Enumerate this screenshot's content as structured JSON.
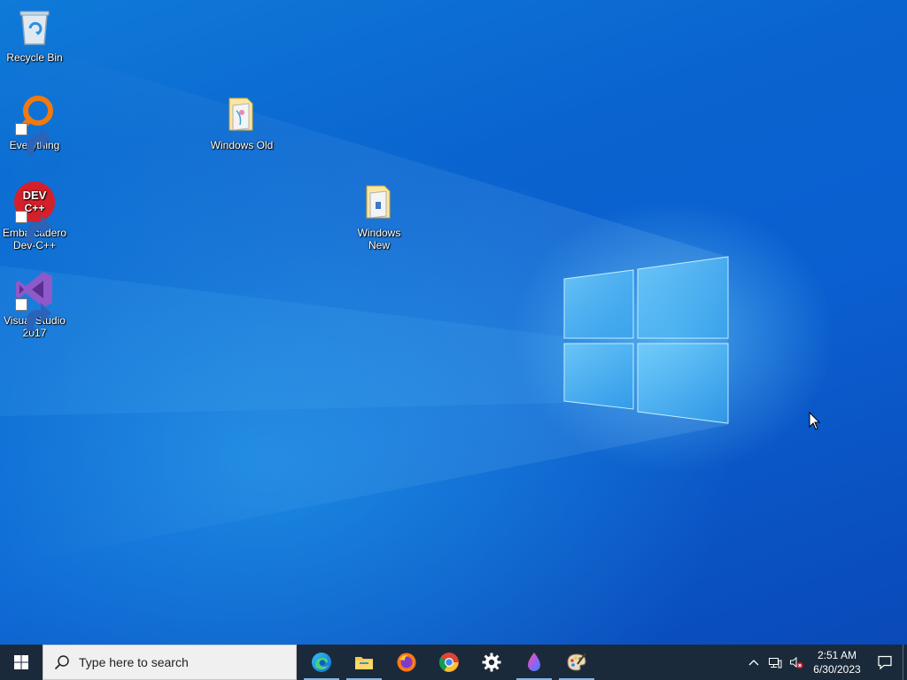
{
  "desktop": {
    "icons": [
      {
        "label": "Recycle Bin",
        "icon": "recycle-bin-icon"
      },
      {
        "label": "Everything",
        "icon": "everything-search-icon"
      },
      {
        "label": "Windows Old",
        "icon": "folder-icon"
      },
      {
        "label": "Embarcadero Dev-C++",
        "icon": "devcpp-icon",
        "badge_text": "DEV C++"
      },
      {
        "label": "Windows New",
        "icon": "folder-icon"
      },
      {
        "label": "Visual Studio 2017",
        "icon": "visual-studio-icon"
      }
    ]
  },
  "taskbar": {
    "search_placeholder": "Type here to search",
    "pinned": [
      {
        "name": "edge",
        "icon": "edge-icon"
      },
      {
        "name": "file-explorer",
        "icon": "folder-icon"
      },
      {
        "name": "firefox",
        "icon": "firefox-icon"
      },
      {
        "name": "chrome",
        "icon": "chrome-icon"
      },
      {
        "name": "settings",
        "icon": "gear-icon"
      },
      {
        "name": "paint-drop",
        "icon": "droplet-icon"
      },
      {
        "name": "paint",
        "icon": "palette-icon"
      }
    ],
    "clock": {
      "time": "2:51 AM",
      "date": "6/30/2023"
    }
  },
  "colors": {
    "taskbar_bg": "#1b2a3a",
    "desktop_blue": "#0a63cf",
    "accent_running": "#8ab4e0"
  }
}
